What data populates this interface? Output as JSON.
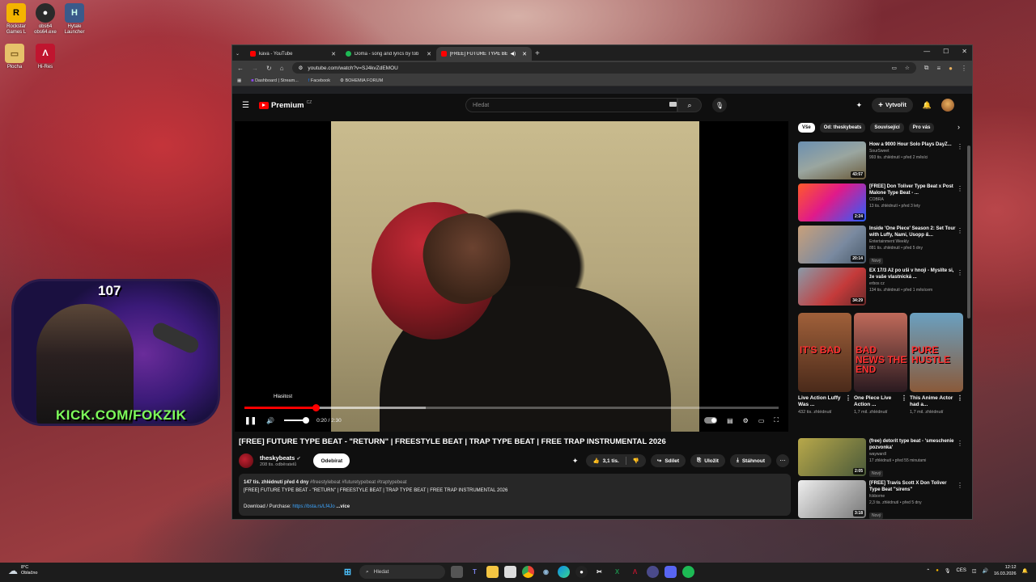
{
  "desktop": {
    "icons": [
      {
        "label": "Rockstar Games L",
        "glyph": "R",
        "color": "#f4b400"
      },
      {
        "label": "obs64 obs64.exe",
        "glyph": "●",
        "color": "#333"
      },
      {
        "label": "Hytale Launcher",
        "glyph": "H",
        "color": "#3a5a8a"
      },
      {
        "label": "Plocha",
        "glyph": "▭",
        "color": "#e6c26a"
      },
      {
        "label": "Hi-Res",
        "glyph": "Λ",
        "color": "#c0152f"
      }
    ]
  },
  "webcam": {
    "count": "107",
    "kick": "KICK.COM/FOKZIK"
  },
  "browser": {
    "tabs": [
      {
        "title": "kava - YouTube",
        "color": "#ff0000"
      },
      {
        "title": "Doma - song and lyrics by tob",
        "color": "#1db954"
      },
      {
        "title": "[FREE] FUTURE TYPE BEAT",
        "color": "#ff0000"
      }
    ],
    "url": "youtube.com/watch?v=SJ4kvZdEMOU",
    "bookmarks": [
      "Dashboard | Stream...",
      "Facebook",
      "BOHEMIA FORUM"
    ]
  },
  "youtube": {
    "logo": "Premium",
    "logo_cc": "CZ",
    "search_placeholder": "Hledat",
    "create_label": "Vytvořit",
    "player": {
      "volume_tooltip": "Hlasitost",
      "time": "0:20 / 2:30",
      "played_fraction": 0.133,
      "buffered_fraction": 0.34
    },
    "video_title": "[FREE] FUTURE TYPE BEAT - \"RETURN\" | FREESTYLE BEAT | TRAP TYPE BEAT | FREE TRAP INSTRUMENTAL 2026",
    "channel": {
      "name": "theskybeats",
      "subs": "208 tis. odběratelů",
      "subscribe": "Odebírat"
    },
    "actions": {
      "likes": "3,1 tis.",
      "share": "Sdílet",
      "save": "Uložit",
      "download": "Stáhnout"
    },
    "description": {
      "views_date": "147 tis. zhlédnutí  před 4 dny",
      "tags": "#freestylebeat #futuretypebeat #traptypebeat",
      "line2": "[FREE] FUTURE TYPE BEAT - \"RETURN\" | FREESTYLE BEAT | TRAP TYPE BEAT | FREE TRAP INSTRUMENTAL 2026",
      "download_label": "Download / Purchase:",
      "link": "https://bsta.rs/Lf4Jo",
      "more": "...více"
    },
    "chips": [
      "Vše",
      "Od: theskybeats",
      "Související",
      "Pro vás"
    ],
    "recommendations": [
      {
        "title": "How a 9000 Hour Solo Plays DayZ...",
        "channel": "SourSweet",
        "meta": "993 tis. zhlédnutí • před 2 měsíci",
        "duration": "43:57",
        "bg": "linear-gradient(160deg,#6b8fb0,#9aa6a0 50%,#6a5a3a)",
        "new": ""
      },
      {
        "title": "[FREE] Don Toliver Type Beat x Post Malone Type Beat - ...",
        "channel": "COBRA",
        "meta": "13 tis. zhlédnutí • před 3 lety",
        "duration": "2:24",
        "bg": "linear-gradient(135deg,#ff5a2a,#e01a8a 45%,#2a60ff)",
        "new": ""
      },
      {
        "title": "Inside 'One Piece' Season 2: Set Tour with Luffy, Nami, Usopp &...",
        "channel": "Entertainment Weekly",
        "meta": "881 tis. zhlédnutí • před 5 dny",
        "duration": "20:14",
        "bg": "linear-gradient(135deg,#c9a07a,#7a8aa0 60%,#4a5a6a)",
        "new": "Nový"
      },
      {
        "title": "EX 17/3 Až po uši v hnoji - Myslíte si, že vaše vlastnická ...",
        "channel": "erbos cz",
        "meta": "134 tis. zhlédnutí • před 1 měsícem",
        "duration": "34:29",
        "bg": "linear-gradient(135deg,#8a9aa8,#c43a3a 60%,#6a2a2a)",
        "new": ""
      }
    ],
    "shorts": [
      {
        "title": "Live Action Luffy Was ...",
        "views": "432 tis. zhlédnutí",
        "text": "IT'S BAD",
        "bg": "linear-gradient(180deg,#a0603a,#4a2a1a)"
      },
      {
        "title": "One Piece Live Action ...",
        "views": "1,7 mil. zhlédnutí",
        "text": "BAD NEWS THE END",
        "bg": "linear-gradient(180deg,#c06a5a,#2a1a20)"
      },
      {
        "title": "This Anime Actor had a...",
        "views": "1,7 mil. zhlédnutí",
        "text": "PURE HUSTLE",
        "bg": "linear-gradient(180deg,#6aa0c0,#8a5a3a)"
      }
    ],
    "recommendations2": [
      {
        "title": "(free) detorit type beat - 'smeschenie pozvonka'",
        "channel": "waywardl",
        "meta": "17 zhlédnutí • před 55 minutami",
        "duration": "2:05",
        "bg": "linear-gradient(135deg,#b8a84a,#4a5a3a)",
        "new": "Nový"
      },
      {
        "title": "[FREE] Travis Scott X Don Toliver Type Beat \"sirens\"",
        "channel": "fckborne",
        "meta": "2,3 tis. zhlédnutí • před 5 dny",
        "duration": "3:18",
        "bg": "linear-gradient(135deg,#eee,#777)",
        "new": "Nový"
      }
    ]
  },
  "taskbar": {
    "weather_temp": "8°C",
    "weather_desc": "Oblačno",
    "search": "Hledat",
    "lang": "CES",
    "time": "12:12",
    "date": "16.03.2026"
  }
}
